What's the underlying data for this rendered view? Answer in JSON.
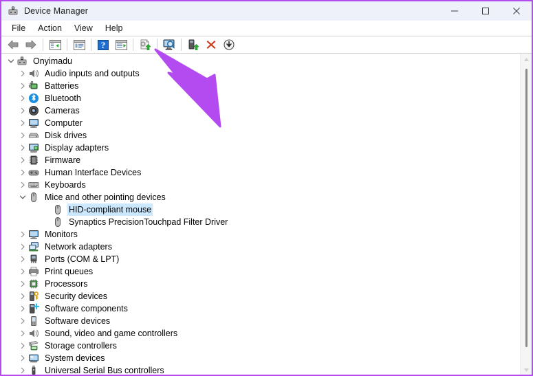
{
  "window": {
    "title": "Device Manager",
    "icon": "device-manager-icon",
    "border_color": "#b44bf0",
    "titlebar_bg": "#eef0fa",
    "controls": [
      {
        "name": "minimize-button",
        "glyph": "—"
      },
      {
        "name": "maximize-button",
        "glyph": "□"
      },
      {
        "name": "close-button",
        "glyph": "✕"
      }
    ]
  },
  "menubar": {
    "items": [
      {
        "label": "File",
        "name": "menu-file"
      },
      {
        "label": "Action",
        "name": "menu-action"
      },
      {
        "label": "View",
        "name": "menu-view"
      },
      {
        "label": "Help",
        "name": "menu-help"
      }
    ]
  },
  "toolbar": {
    "buttons": [
      {
        "name": "back-button",
        "icon": "back-arrow-icon",
        "type": "icon"
      },
      {
        "name": "forward-button",
        "icon": "forward-arrow-icon",
        "type": "icon"
      },
      {
        "name": "separator-1",
        "type": "separator"
      },
      {
        "name": "show-hide-console-tree-button",
        "icon": "console-tree-icon",
        "type": "icon"
      },
      {
        "name": "separator-2",
        "type": "separator"
      },
      {
        "name": "properties-button",
        "icon": "properties-icon",
        "type": "icon"
      },
      {
        "name": "separator-3",
        "type": "separator"
      },
      {
        "name": "help-button",
        "icon": "help-question-icon",
        "type": "icon"
      },
      {
        "name": "show-hide-action-pane-button",
        "icon": "action-pane-icon",
        "type": "icon"
      },
      {
        "name": "separator-4",
        "type": "separator"
      },
      {
        "name": "update-driver-button",
        "icon": "update-driver-icon",
        "type": "icon"
      },
      {
        "name": "separator-5",
        "type": "separator"
      },
      {
        "name": "scan-for-hardware-changes-button",
        "icon": "scan-hardware-icon",
        "type": "icon"
      },
      {
        "name": "separator-6",
        "type": "separator"
      },
      {
        "name": "enable-device-button",
        "icon": "enable-device-icon",
        "type": "icon"
      },
      {
        "name": "uninstall-device-button",
        "icon": "red-x-icon",
        "type": "icon"
      },
      {
        "name": "disable-device-button",
        "icon": "down-arrow-circle-icon",
        "type": "icon"
      }
    ]
  },
  "tree": {
    "selected": "HID-compliant mouse",
    "selection_color": "#cce8ff",
    "nodes": [
      {
        "label": "Onyimadu",
        "level": 0,
        "state": "expanded",
        "icon": "computer-root-icon",
        "selected": false
      },
      {
        "label": "Audio inputs and outputs",
        "level": 1,
        "state": "collapsed",
        "icon": "speaker-icon",
        "selected": false
      },
      {
        "label": "Batteries",
        "level": 1,
        "state": "collapsed",
        "icon": "battery-icon",
        "selected": false
      },
      {
        "label": "Bluetooth",
        "level": 1,
        "state": "collapsed",
        "icon": "bluetooth-icon",
        "selected": false
      },
      {
        "label": "Cameras",
        "level": 1,
        "state": "collapsed",
        "icon": "camera-icon",
        "selected": false
      },
      {
        "label": "Computer",
        "level": 1,
        "state": "collapsed",
        "icon": "monitor-icon",
        "selected": false
      },
      {
        "label": "Disk drives",
        "level": 1,
        "state": "collapsed",
        "icon": "disk-drive-icon",
        "selected": false
      },
      {
        "label": "Display adapters",
        "level": 1,
        "state": "collapsed",
        "icon": "display-adapter-icon",
        "selected": false
      },
      {
        "label": "Firmware",
        "level": 1,
        "state": "collapsed",
        "icon": "firmware-chip-icon",
        "selected": false
      },
      {
        "label": "Human Interface Devices",
        "level": 1,
        "state": "collapsed",
        "icon": "gamepad-icon",
        "selected": false
      },
      {
        "label": "Keyboards",
        "level": 1,
        "state": "collapsed",
        "icon": "keyboard-icon",
        "selected": false
      },
      {
        "label": "Mice and other pointing devices",
        "level": 1,
        "state": "expanded",
        "icon": "mouse-icon",
        "selected": false
      },
      {
        "label": "HID-compliant mouse",
        "level": 2,
        "state": "leaf",
        "icon": "mouse-icon",
        "selected": true
      },
      {
        "label": "Synaptics PrecisionTouchpad Filter Driver",
        "level": 2,
        "state": "leaf",
        "icon": "mouse-icon",
        "selected": false
      },
      {
        "label": "Monitors",
        "level": 1,
        "state": "collapsed",
        "icon": "monitor-icon",
        "selected": false
      },
      {
        "label": "Network adapters",
        "level": 1,
        "state": "collapsed",
        "icon": "network-adapter-icon",
        "selected": false
      },
      {
        "label": "Ports (COM & LPT)",
        "level": 1,
        "state": "collapsed",
        "icon": "port-icon",
        "selected": false
      },
      {
        "label": "Print queues",
        "level": 1,
        "state": "collapsed",
        "icon": "printer-icon",
        "selected": false
      },
      {
        "label": "Processors",
        "level": 1,
        "state": "collapsed",
        "icon": "processor-icon",
        "selected": false
      },
      {
        "label": "Security devices",
        "level": 1,
        "state": "collapsed",
        "icon": "security-key-icon",
        "selected": false
      },
      {
        "label": "Software components",
        "level": 1,
        "state": "collapsed",
        "icon": "software-component-icon",
        "selected": false
      },
      {
        "label": "Software devices",
        "level": 1,
        "state": "collapsed",
        "icon": "software-device-icon",
        "selected": false
      },
      {
        "label": "Sound, video and game controllers",
        "level": 1,
        "state": "collapsed",
        "icon": "speaker-icon",
        "selected": false
      },
      {
        "label": "Storage controllers",
        "level": 1,
        "state": "collapsed",
        "icon": "storage-controller-icon",
        "selected": false
      },
      {
        "label": "System devices",
        "level": 1,
        "state": "collapsed",
        "icon": "system-device-icon",
        "selected": false
      },
      {
        "label": "Universal Serial Bus controllers",
        "level": 1,
        "state": "collapsed",
        "icon": "usb-icon",
        "selected": false
      }
    ]
  },
  "scrollbar": {
    "name": "vertical-scrollbar",
    "up_arrow": "scroll-up-arrow",
    "down_arrow": "scroll-down-arrow"
  },
  "annotation": {
    "type": "arrow",
    "color": "#b44bf0",
    "points_to": "scan-for-hardware-changes-button"
  }
}
